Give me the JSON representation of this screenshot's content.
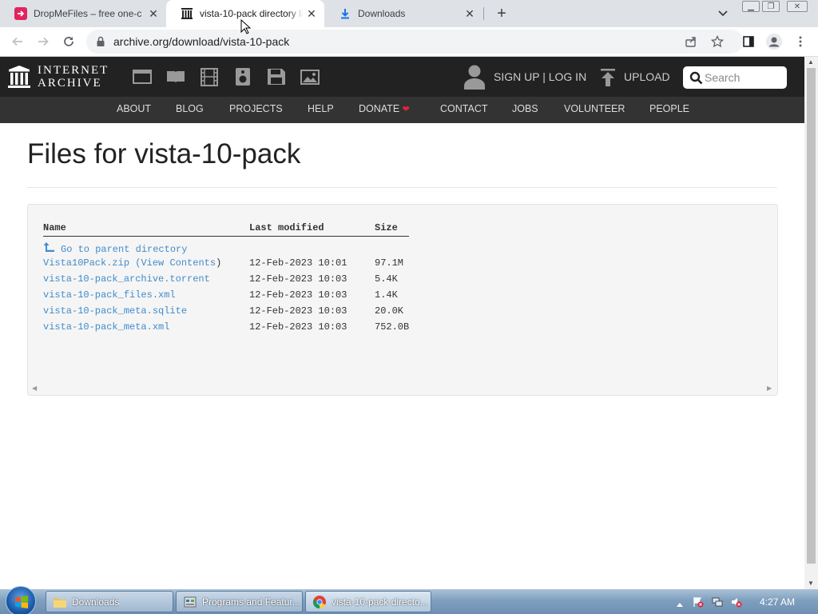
{
  "browser": {
    "tabs": [
      {
        "title": "DropMeFiles – free one-c",
        "icon": "dropmefiles-favicon",
        "active": false
      },
      {
        "title": "vista-10-pack directory li",
        "icon": "archive-favicon",
        "active": true
      },
      {
        "title": "Downloads",
        "icon": "download-favicon",
        "active": false
      }
    ],
    "new_tab_label": "+",
    "url": "archive.org/download/vista-10-pack"
  },
  "site": {
    "logo_line1": "INTERNET",
    "logo_line2": "ARCHIVE",
    "signup_label": "SIGN UP | LOG IN",
    "upload_label": "UPLOAD",
    "search_placeholder": "Search",
    "nav": [
      "ABOUT",
      "BLOG",
      "PROJECTS",
      "HELP",
      "DONATE",
      "CONTACT",
      "JOBS",
      "VOLUNTEER",
      "PEOPLE"
    ]
  },
  "page": {
    "title": "Files for vista-10-pack",
    "columns": {
      "name": "Name",
      "modified": "Last modified",
      "size": "Size"
    },
    "parent_link": "Go to parent directory",
    "files": [
      {
        "name": "Vista10Pack.zip",
        "extra_open": "(",
        "extra_link": "View Contents",
        "extra_close": ")",
        "modified": "12-Feb-2023 10:01",
        "size": "97.1M"
      },
      {
        "name": "vista-10-pack_archive.torrent",
        "modified": "12-Feb-2023 10:03",
        "size": "5.4K"
      },
      {
        "name": "vista-10-pack_files.xml",
        "modified": "12-Feb-2023 10:03",
        "size": "1.4K"
      },
      {
        "name": "vista-10-pack_meta.sqlite",
        "modified": "12-Feb-2023 10:03",
        "size": "20.0K"
      },
      {
        "name": "vista-10-pack_meta.xml",
        "modified": "12-Feb-2023 10:03",
        "size": "752.0B"
      }
    ]
  },
  "taskbar": {
    "items": [
      {
        "label": "Downloads",
        "icon": "folder-icon",
        "active": false
      },
      {
        "label": "Programs and Featur...",
        "icon": "control-panel-icon",
        "active": false
      },
      {
        "label": "vista-10-pack directo...",
        "icon": "chrome-icon",
        "active": true
      }
    ],
    "clock": "4:27 AM"
  },
  "colors": {
    "link": "#428bca",
    "ia_header": "#222222",
    "ia_nav": "#333333",
    "donate_heart": "#e0243a"
  }
}
